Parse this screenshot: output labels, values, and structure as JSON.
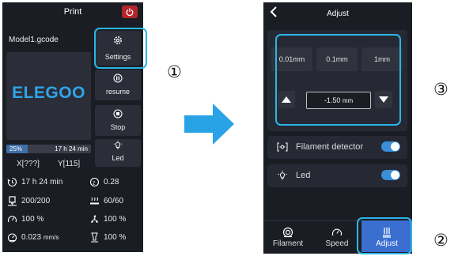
{
  "left": {
    "title": "Print",
    "filename": "Model1.gcode",
    "logo": "ELEGOO",
    "buttons": {
      "settings": "Settings",
      "resume": "resume",
      "stop": "Stop",
      "led": "Led"
    },
    "progress": {
      "percent_label": "25%",
      "percent": 25,
      "remaining": "17 h 24 min"
    },
    "coords": {
      "x": "X[???]",
      "y": "Y[115]"
    },
    "stats": {
      "print_time": "17 h 24 min",
      "layer_height": "0.28",
      "nozzle_temp": "200/200",
      "bed_temp": "60/60",
      "speed": "100 %",
      "fan": "100 %",
      "flow_value": "0.023",
      "flow_unit": "mm/s",
      "flow_rate": "100 %"
    }
  },
  "right": {
    "title": "Adjust",
    "steps": [
      "0.01mm",
      "0.1mm",
      "1mm"
    ],
    "z_offset": {
      "value": "-1.50",
      "unit": "mm"
    },
    "toggles": {
      "filament_detector": {
        "label": "Filament detector",
        "on": true
      },
      "led": {
        "label": "Led",
        "on": true
      }
    },
    "tabs": [
      "Filament",
      "Speed",
      "Adjust"
    ],
    "active_tab": "Adjust"
  },
  "annotations": {
    "one": "①",
    "two": "②",
    "three": "③"
  },
  "colors": {
    "accent": "#29b6e8",
    "brand": "#2fa6e8",
    "toggle_on": "#3a8fd9",
    "active_tab": "#3a6fd0",
    "stop_red": "#b3242b"
  },
  "icons": [
    "power-icon",
    "gear-icon",
    "pause-icon",
    "stop-icon",
    "bulb-icon",
    "clock-icon",
    "layer-icon",
    "nozzle-icon",
    "heatbed-icon",
    "speedometer-icon",
    "fan-icon",
    "gauge-icon",
    "flow-icon",
    "back-arrow-icon",
    "triangle-up-icon",
    "triangle-down-icon",
    "filament-sensor-icon",
    "filament-spool-icon",
    "sliders-icon",
    "right-arrow-icon"
  ]
}
